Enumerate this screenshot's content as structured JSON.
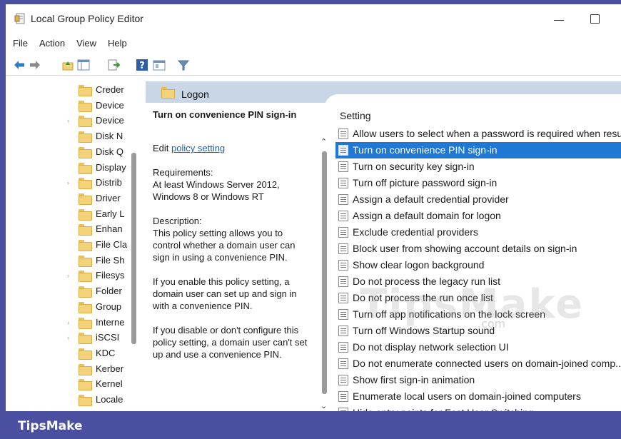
{
  "window": {
    "title": "Local Group Policy Editor"
  },
  "menu": [
    "File",
    "Action",
    "View",
    "Help"
  ],
  "toolbar_icons": [
    "back-arrow-icon",
    "forward-arrow-icon",
    "up-folder-icon",
    "show-hide-tree-icon",
    "export-list-icon",
    "help-icon",
    "properties-icon",
    "filter-icon"
  ],
  "tree": {
    "items": [
      {
        "label": "Creder",
        "expandable": false
      },
      {
        "label": "Device",
        "expandable": false
      },
      {
        "label": "Device",
        "expandable": true
      },
      {
        "label": "Disk N",
        "expandable": false
      },
      {
        "label": "Disk Q",
        "expandable": false
      },
      {
        "label": "Display",
        "expandable": false
      },
      {
        "label": "Distrib",
        "expandable": true
      },
      {
        "label": "Driver",
        "expandable": false
      },
      {
        "label": "Early L",
        "expandable": false
      },
      {
        "label": "Enhan",
        "expandable": false
      },
      {
        "label": "File Cla",
        "expandable": false
      },
      {
        "label": "File Sh",
        "expandable": false
      },
      {
        "label": "Filesys",
        "expandable": true
      },
      {
        "label": "Folder",
        "expandable": false
      },
      {
        "label": "Group",
        "expandable": false
      },
      {
        "label": "Interne",
        "expandable": true
      },
      {
        "label": "iSCSI",
        "expandable": true
      },
      {
        "label": "KDC",
        "expandable": false
      },
      {
        "label": "Kerber",
        "expandable": false
      },
      {
        "label": "Kernel",
        "expandable": false
      },
      {
        "label": "Locale",
        "expandable": false
      }
    ]
  },
  "content": {
    "folder_title": "Logon",
    "description": {
      "title": "Turn on convenience PIN sign-in",
      "edit_prefix": "Edit ",
      "edit_link": "policy setting",
      "requirements": "Requirements:\nAt least Windows Server 2012, Windows 8 or Windows RT",
      "description": "Description:\nThis policy setting allows you to control whether a domain user can sign in using a convenience PIN.",
      "enable_text": "If you enable this policy setting, a domain user can set up and sign in with a convenience PIN.",
      "disable_text": "If you disable or don't configure this policy setting, a domain user can't set up and use a convenience PIN."
    },
    "settings_header": "Setting",
    "settings": [
      {
        "label": "Allow users to select when a password is required when resu...",
        "selected": false
      },
      {
        "label": "Turn on convenience PIN sign-in",
        "selected": true
      },
      {
        "label": "Turn on security key sign-in",
        "selected": false
      },
      {
        "label": "Turn off picture password sign-in",
        "selected": false
      },
      {
        "label": "Assign a default credential provider",
        "selected": false
      },
      {
        "label": "Assign a default domain for logon",
        "selected": false
      },
      {
        "label": "Exclude credential providers",
        "selected": false
      },
      {
        "label": "Block user from showing account details on sign-in",
        "selected": false
      },
      {
        "label": "Show clear logon background",
        "selected": false
      },
      {
        "label": "Do not process the legacy run list",
        "selected": false
      },
      {
        "label": "Do not process the run once list",
        "selected": false
      },
      {
        "label": "Turn off app notifications on the lock screen",
        "selected": false
      },
      {
        "label": "Turn off Windows Startup sound",
        "selected": false
      },
      {
        "label": "Do not display network selection UI",
        "selected": false
      },
      {
        "label": "Do not enumerate connected users on domain-joined comp...",
        "selected": false
      },
      {
        "label": "Show first sign-in animation",
        "selected": false
      },
      {
        "label": "Enumerate local users on domain-joined computers",
        "selected": false
      },
      {
        "label": "Hide entry points for Fast User Switching",
        "selected": false
      }
    ]
  },
  "watermark": {
    "text": "TipsMake",
    "sub": ".com"
  },
  "footer": {
    "brand": "TipsMake"
  },
  "colors": {
    "accent": "#1e78d4",
    "footer": "#4a4fa0",
    "header_band": "#c8d6e6"
  }
}
